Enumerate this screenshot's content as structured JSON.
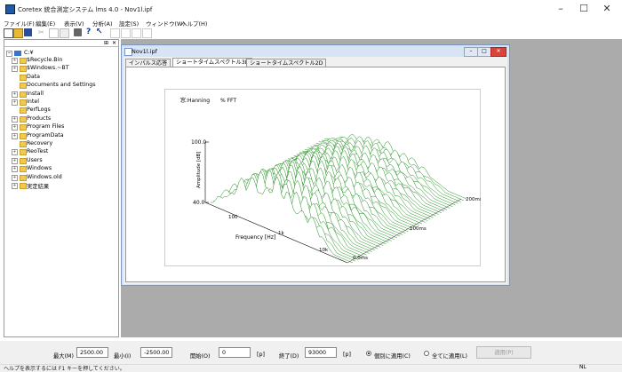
{
  "app": {
    "title": "Coretex 統合測定システム lms 4.0 - Nov1l.ipf",
    "controls": [
      "–",
      "☐",
      "✕"
    ]
  },
  "menu": [
    "ファイル(F)",
    "編集(E)",
    "表示(V)",
    "分析(A)",
    "設定(S)",
    "ウィンドウ(W)",
    "ヘルプ(H)"
  ],
  "tree": {
    "root": "C:¥",
    "items": [
      {
        "label": "$Recycle.Bin",
        "expandable": true
      },
      {
        "label": "$Windows.~BT",
        "expandable": true
      },
      {
        "label": "Data",
        "expandable": false
      },
      {
        "label": "Documents and Settings",
        "expandable": false
      },
      {
        "label": "Install",
        "expandable": true
      },
      {
        "label": "Intel",
        "expandable": true
      },
      {
        "label": "PerfLogs",
        "expandable": false
      },
      {
        "label": "Products",
        "expandable": true
      },
      {
        "label": "Program Files",
        "expandable": true
      },
      {
        "label": "ProgramData",
        "expandable": true
      },
      {
        "label": "Recovery",
        "expandable": false
      },
      {
        "label": "ReoTest",
        "expandable": true
      },
      {
        "label": "Users",
        "expandable": true
      },
      {
        "label": "Windows",
        "expandable": true
      },
      {
        "label": "Windows.old",
        "expandable": true
      },
      {
        "label": "実定結果",
        "expandable": true
      }
    ]
  },
  "child_window": {
    "title": "Nov1l.ipf",
    "tabs": [
      "インパルス応答",
      "ショートタイムスペクトル3D",
      "ショートタイムスペクトル2D"
    ],
    "active_tab": 1
  },
  "chart_data": {
    "type": "surface3d",
    "annotations": [
      "窓:Hanning",
      "% FFT"
    ],
    "zlabel": "Amplitude [dB]",
    "z_ticks": [
      "100.0",
      "40.0"
    ],
    "xlabel": "Frequency [Hz]",
    "x_ticks": [
      "100",
      "1k",
      "10k"
    ],
    "time_ticks": [
      "200ms",
      "100ms",
      "0.0ms"
    ],
    "color": "#1f8f1f"
  },
  "params": {
    "max_label": "最大(M)",
    "max_value": "2500.00",
    "min_label": "最小(I)",
    "min_value": "-2500.00",
    "start_label": "開始(O)",
    "start_value": "0",
    "start_unit": "[p]",
    "end_label": "終了(D)",
    "end_value": "93000",
    "end_unit": "[p]",
    "radio1_label": "個別に適用(C)",
    "radio2_label": "全てに適用(L)",
    "apply_label": "適用(P)"
  },
  "status": {
    "text": "ヘルプを表示するには F1 キーを押してください。",
    "indicator": "NL"
  }
}
